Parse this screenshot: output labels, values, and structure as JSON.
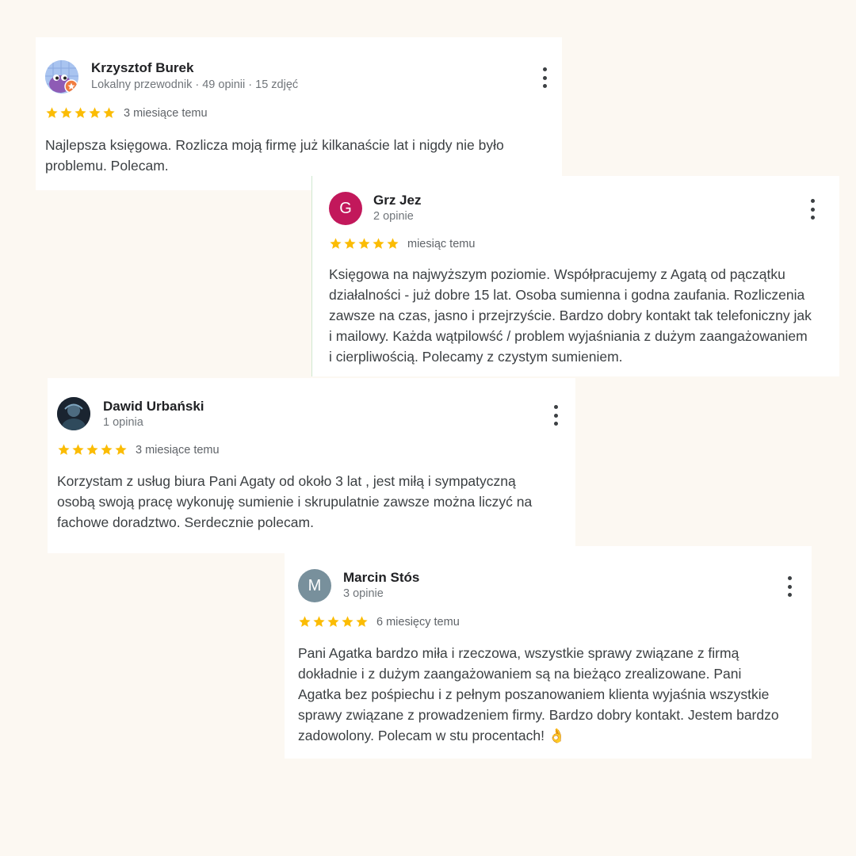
{
  "colors": {
    "star": "#fbbc04",
    "background": "#fcf8f2",
    "card": "#ffffff"
  },
  "reviews": [
    {
      "name": "Krzysztof Burek",
      "meta": "Lokalny przewodnik · 49 opinii · 15 zdjęć",
      "rating": 5,
      "time": "3 miesiące temu",
      "avatar": {
        "type": "image",
        "description": "purple character with local guide badge"
      },
      "lines": [
        "Najlepsza księgowa. Rozlicza moją firmę już kilkanaście lat i nigdy nie było",
        "problemu. Polecam."
      ]
    },
    {
      "name": "Grz Jez",
      "meta": "2 opinie",
      "rating": 5,
      "time": "miesiąc temu",
      "avatar": {
        "type": "letter",
        "letter": "G",
        "color": "#c2185b"
      },
      "lines": [
        "Księgowa na najwyższym poziomie. Współpracujemy z Agatą od pączątku",
        "działalności - już dobre 15 lat. Osoba sumienna i godna zaufania. Rozliczenia",
        "zawsze na czas, jasno i przejrzyście. Bardzo dobry kontakt tak telefoniczny jak",
        "i mailowy. Każda wątpilowść / problem wyjaśniania z dużym zaangażowaniem",
        "i cierpliwością. Polecamy z czystym sumieniem."
      ]
    },
    {
      "name": "Dawid Urbański",
      "meta": "1 opinia",
      "rating": 5,
      "time": "3 miesiące temu",
      "avatar": {
        "type": "image",
        "description": "dark photo portrait"
      },
      "lines": [
        "Korzystam z usług biura Pani Agaty od około 3 lat , jest miłą i sympatyczną",
        "osobą swoją pracę wykonuję sumienie i skrupulatnie zawsze można liczyć na",
        "fachowe doradztwo. Serdecznie polecam."
      ]
    },
    {
      "name": "Marcin Stós",
      "meta": "3 opinie",
      "rating": 5,
      "time": "6 miesięcy temu",
      "avatar": {
        "type": "letter",
        "letter": "M",
        "color": "#78909c"
      },
      "lines": [
        "Pani Agatka bardzo miła i rzeczowa, wszystkie sprawy związane z firmą",
        "dokładnie i z dużym zaangażowaniem są na bieżąco zrealizowane. Pani",
        "Agatka bez pośpiechu i z pełnym poszanowaniem klienta wyjaśnia wszystkie",
        "sprawy związane z prowadzeniem firmy. Bardzo dobry kontakt. Jestem bardzo",
        "zadowolony. Polecam w stu procentach! 👌"
      ]
    }
  ]
}
